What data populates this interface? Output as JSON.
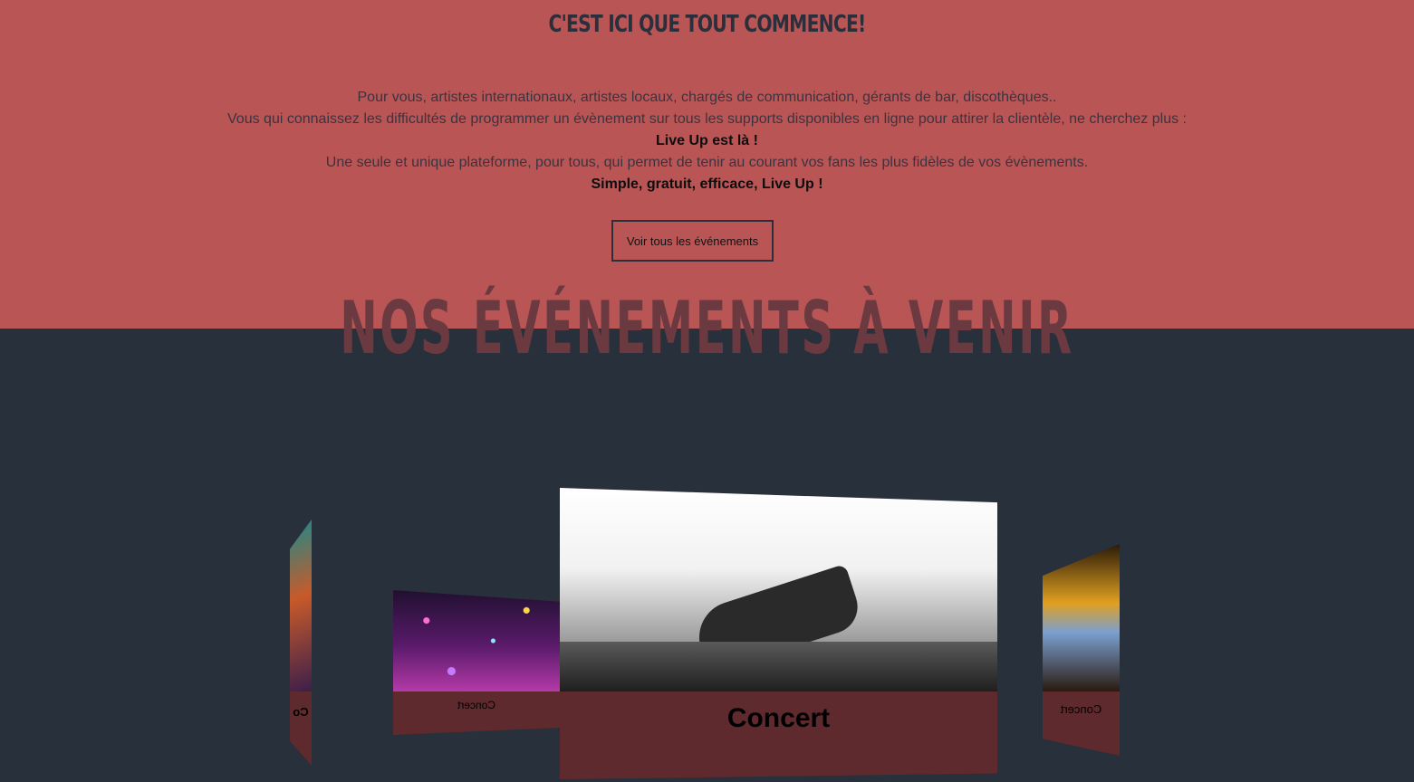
{
  "hero": {
    "title": "C'EST ICI QUE TOUT COMMENCE!",
    "lines": [
      "Pour vous, artistes internationaux, artistes locaux, chargés de communication, gérants de bar, discothèques..",
      "Vous qui connaissez les difficultés de programmer un évènement sur tous les supports disponibles en ligne pour attirer la clientèle, ne cherchez plus :",
      "Live Up est là !",
      "Une seule et unique plateforme, pour tous, qui permet de tenir au courant vos fans les plus fidèles de vos évènements.",
      "Simple, gratuit, efficace, Live Up !"
    ],
    "cta_label": "Voir tous les événements"
  },
  "events": {
    "title": "NOS ÉVÉNEMENTS À VENIR",
    "cards": [
      {
        "label": "Co"
      },
      {
        "label": "Concert"
      },
      {
        "label": "Concert"
      },
      {
        "label": "Concert"
      }
    ]
  },
  "colors": {
    "hero_bg": "#b95555",
    "dark_bg": "#28303c",
    "card_footer": "#5e2a2d"
  }
}
